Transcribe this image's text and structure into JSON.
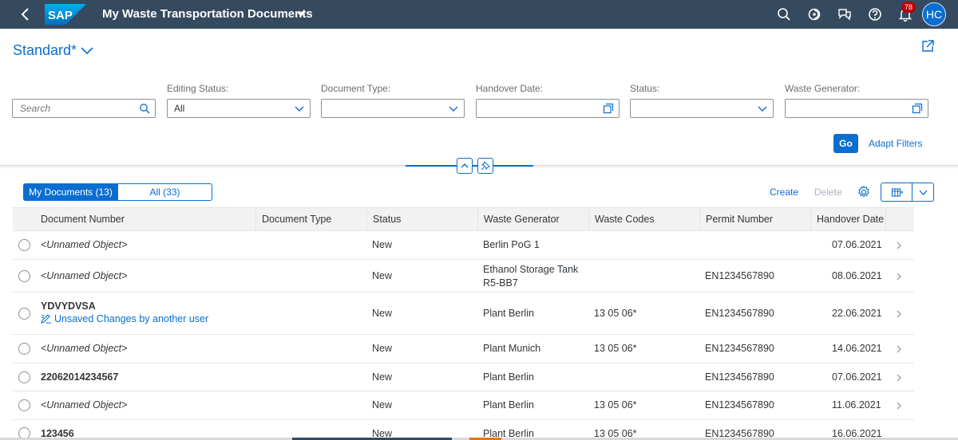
{
  "shell": {
    "logo_text": "SAP",
    "app_title": "My Waste Transportation Documents",
    "notification_count": "78",
    "user_initials": "HC"
  },
  "variant": {
    "name": "Standard*"
  },
  "filters": {
    "search_placeholder": "Search",
    "editing_status": {
      "label": "Editing Status:",
      "value": "All"
    },
    "document_type": {
      "label": "Document Type:",
      "value": ""
    },
    "handover_date": {
      "label": "Handover Date:",
      "value": ""
    },
    "status": {
      "label": "Status:",
      "value": ""
    },
    "waste_generator": {
      "label": "Waste Generator:",
      "value": ""
    },
    "go_label": "Go",
    "adapt_filters_label": "Adapt Filters"
  },
  "toolbar": {
    "my_documents_label": "My Documents (13)",
    "all_label": "All (33)",
    "create_label": "Create",
    "delete_label": "Delete"
  },
  "table": {
    "columns": [
      "Document Number",
      "Document Type",
      "Status",
      "Waste Generator",
      "Waste Codes",
      "Permit Number",
      "Handover Date"
    ],
    "rows": [
      {
        "doc": "<Unnamed Object>",
        "type": "",
        "status": "New",
        "generator": "Berlin PoG 1",
        "generator2": "",
        "codes": "",
        "permit": "",
        "date": "07.06.2021",
        "unsaved": ""
      },
      {
        "doc": "<Unnamed Object>",
        "type": "",
        "status": "New",
        "generator": "Ethanol Storage Tank",
        "generator2": "R5-BB7",
        "codes": "",
        "permit": "EN1234567890",
        "date": "08.06.2021",
        "unsaved": ""
      },
      {
        "doc": "YDVYDVSA",
        "type": "",
        "status": "New",
        "generator": "Plant Berlin",
        "generator2": "",
        "codes": "13 05 06*",
        "permit": "EN1234567890",
        "date": "22.06.2021",
        "unsaved": "Unsaved Changes by another user"
      },
      {
        "doc": "<Unnamed Object>",
        "type": "",
        "status": "New",
        "generator": "Plant Munich",
        "generator2": "",
        "codes": "13 05 06*",
        "permit": "EN1234567890",
        "date": "14.06.2021",
        "unsaved": ""
      },
      {
        "doc": "22062014234567",
        "type": "",
        "status": "New",
        "generator": "Plant Berlin",
        "generator2": "",
        "codes": "",
        "permit": "EN1234567890",
        "date": "07.06.2021",
        "unsaved": ""
      },
      {
        "doc": "<Unnamed Object>",
        "type": "",
        "status": "New",
        "generator": "Plant Berlin",
        "generator2": "",
        "codes": "13 05 06*",
        "permit": "EN1234567890",
        "date": "11.06.2021",
        "unsaved": ""
      },
      {
        "doc": "123456",
        "type": "",
        "status": "New",
        "generator": "Plant Berlin",
        "generator2": "",
        "codes": "13 05 06*",
        "permit": "EN1234567890",
        "date": "16.06.2021",
        "unsaved": ""
      }
    ]
  },
  "colors": {
    "shell_bg": "#354a5f",
    "accent": "#0a6ed1",
    "badge": "#bb0000"
  }
}
